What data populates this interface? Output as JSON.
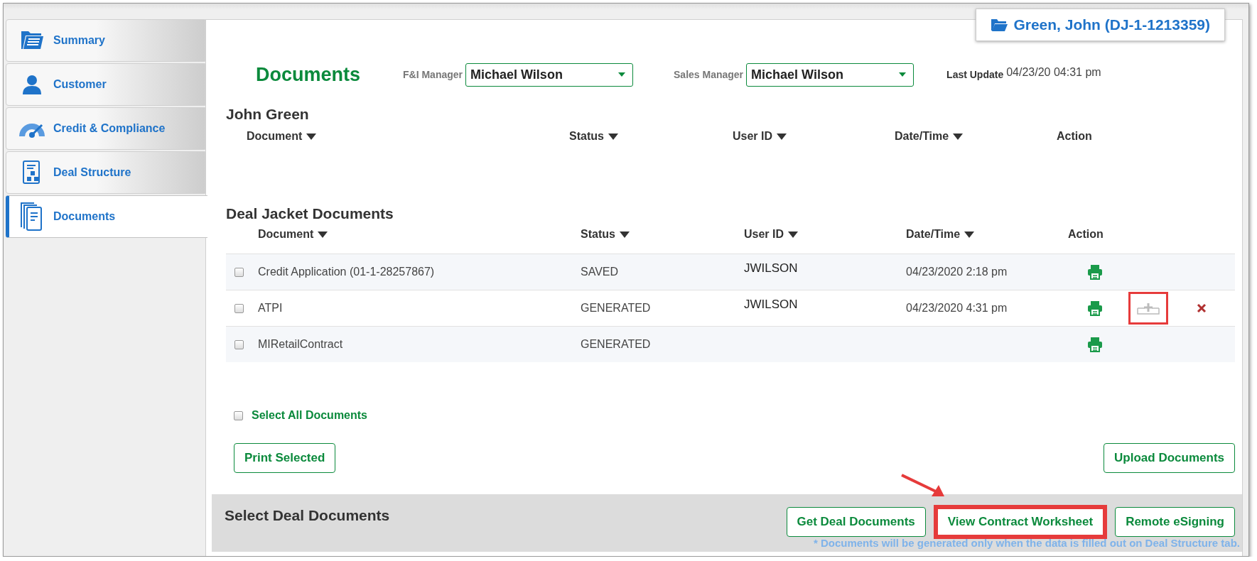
{
  "sidebar": {
    "items": [
      {
        "label": "Summary",
        "kind": "summary",
        "selected": false
      },
      {
        "label": "Customer",
        "kind": "customer",
        "selected": false
      },
      {
        "label": "Credit & Compliance",
        "kind": "gauge",
        "selected": false
      },
      {
        "label": "Deal Structure",
        "kind": "deal",
        "selected": false
      },
      {
        "label": "Documents",
        "kind": "documents",
        "selected": true
      }
    ]
  },
  "customer_badge": {
    "text": "Green, John (DJ-1-1213359)"
  },
  "header": {
    "title": "Documents",
    "fi_manager": {
      "label": "F&I Manager",
      "value": "Michael Wilson"
    },
    "sales_manager": {
      "label": "Sales Manager",
      "value": "Michael Wilson"
    },
    "last_update": {
      "label": "Last Update",
      "value": "04/23/20 04:31 pm"
    }
  },
  "customer_documents": {
    "title": "John Green",
    "columns": [
      {
        "label": "Document",
        "sortable": true
      },
      {
        "label": "Status",
        "sortable": true
      },
      {
        "label": "User ID",
        "sortable": true
      },
      {
        "label": "Date/Time",
        "sortable": true
      },
      {
        "label": "Action",
        "sortable": false
      }
    ]
  },
  "deal_jacket": {
    "title": "Deal Jacket Documents",
    "columns": [
      {
        "label": "Document",
        "sortable": true
      },
      {
        "label": "Status",
        "sortable": true
      },
      {
        "label": "User ID",
        "sortable": true
      },
      {
        "label": "Date/Time",
        "sortable": true
      },
      {
        "label": "Action",
        "sortable": false
      }
    ],
    "rows": [
      {
        "checked": false,
        "document": "Credit Application (01-1-28257867)",
        "status": "SAVED",
        "user_id": "JWILSON",
        "datetime": "04/23/2020 2:18 pm",
        "actions": [
          {
            "kind": "print",
            "highlighted": false
          }
        ]
      },
      {
        "checked": false,
        "document": "ATPI",
        "status": "GENERATED",
        "user_id": "JWILSON",
        "datetime": "04/23/2020 4:31 pm",
        "actions": [
          {
            "kind": "print",
            "highlighted": false
          },
          {
            "kind": "add",
            "highlighted": true
          },
          {
            "kind": "delete",
            "highlighted": false
          }
        ]
      },
      {
        "checked": false,
        "document": "MIRetailContract",
        "status": "GENERATED",
        "user_id": "",
        "datetime": "",
        "actions": [
          {
            "kind": "print",
            "highlighted": false
          }
        ]
      }
    ]
  },
  "select_all": {
    "label": "Select All Documents",
    "checked": false
  },
  "print_selected_button": {
    "label": "Print Selected"
  },
  "upload_button": {
    "label": "Upload Documents"
  },
  "select_deal_documents": {
    "title": "Select Deal Documents",
    "buttons": [
      {
        "label": "Get Deal Documents",
        "highlighted": false
      },
      {
        "label": "View Contract Worksheet",
        "highlighted": true
      },
      {
        "label": "Remote eSigning",
        "highlighted": false
      }
    ],
    "note": "* Documents will be generated only when the data is filled out on Deal Structure tab."
  }
}
